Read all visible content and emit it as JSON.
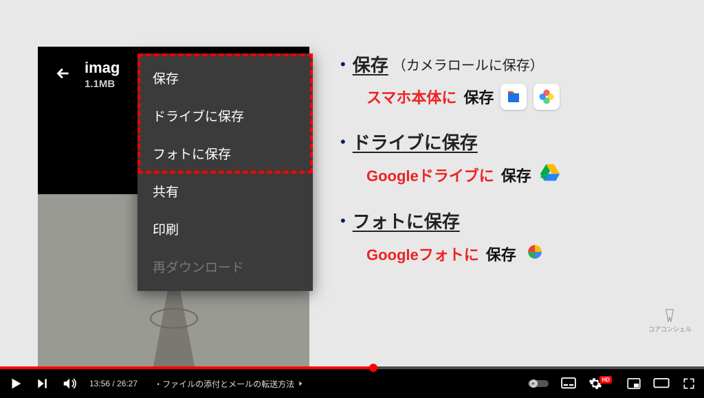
{
  "player": {
    "current_time": "13:56",
    "duration": "26:27",
    "chapter_title": "・ファイルの添付とメールの転送方法"
  },
  "phone": {
    "filename": "imag",
    "filesize": "1.1MB"
  },
  "menu": {
    "items": [
      {
        "label": "保存",
        "disabled": false
      },
      {
        "label": "ドライブに保存",
        "disabled": false
      },
      {
        "label": "フォトに保存",
        "disabled": false
      },
      {
        "label": "共有",
        "disabled": false
      },
      {
        "label": "印刷",
        "disabled": false
      },
      {
        "label": "再ダウンロード",
        "disabled": true
      }
    ]
  },
  "explain": {
    "row1": {
      "title": "保存",
      "paren": "（カメラロールに保存）",
      "sub_red": "スマホ本体に",
      "sub_black": "保存"
    },
    "row2": {
      "title": "ドライブに保存",
      "sub_red": "Googleドライブに",
      "sub_black": "保存"
    },
    "row3": {
      "title": "フォトに保存",
      "sub_red": "Googleフォトに",
      "sub_black": "保存"
    }
  },
  "brand": "コアコンシェル"
}
